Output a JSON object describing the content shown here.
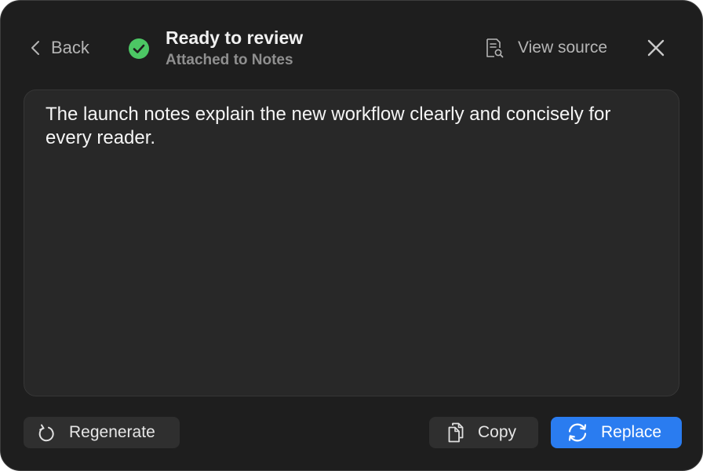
{
  "header": {
    "back_label": "Back",
    "status_title": "Ready to review",
    "status_subtitle": "Attached to Notes",
    "view_source_label": "View source"
  },
  "editor": {
    "text": "The launch notes explain the new workflow clearly and concisely for every reader."
  },
  "actions": {
    "regenerate_label": "Regenerate",
    "copy_label": "Copy",
    "replace_label": "Replace"
  },
  "colors": {
    "background": "#1e1e1e",
    "editor_background": "#282828",
    "success": "#4cc764",
    "accent": "#2a7cf0"
  },
  "icons": {
    "back": "chevron-left-icon",
    "status": "check-circle-icon",
    "view_source": "document-search-icon",
    "close": "close-icon",
    "regenerate": "refresh-icon",
    "copy": "copy-icon",
    "replace": "sync-icon"
  }
}
